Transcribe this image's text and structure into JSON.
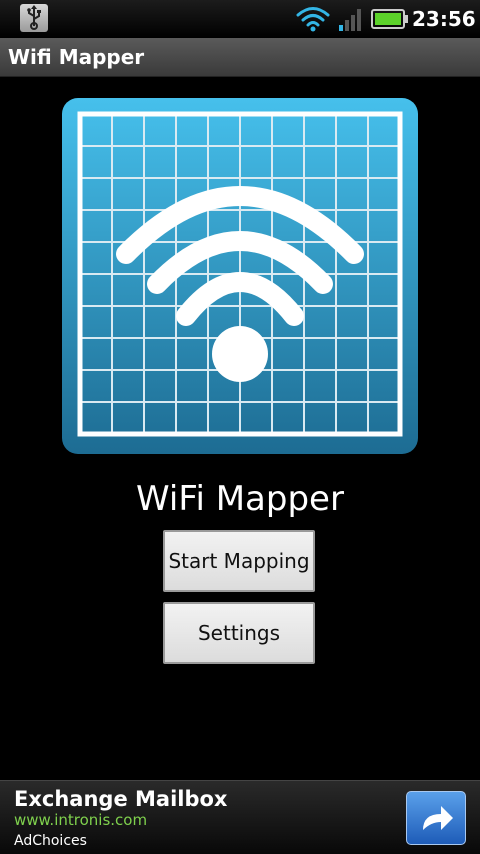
{
  "status_bar": {
    "time": "23:56",
    "icons": [
      "usb-icon",
      "wifi-signal-icon",
      "cell-signal-icon",
      "battery-icon"
    ]
  },
  "app_bar": {
    "title": "Wifi Mapper"
  },
  "main": {
    "logo_icon": "wifi-grid-logo-icon",
    "app_name": "WiFi Mapper",
    "start_button_label": "Start Mapping",
    "settings_button_label": "Settings"
  },
  "ad": {
    "title": "Exchange Mailbox",
    "url": "www.intronis.com",
    "choices": "AdChoices",
    "action_icon": "share-arrow-icon"
  },
  "colors": {
    "background": "#000000",
    "logo_blue_light": "#3fb8e6",
    "logo_blue_dark": "#1f6f96",
    "ad_url_green": "#7fd14d",
    "battery_green": "#5cd22a"
  }
}
